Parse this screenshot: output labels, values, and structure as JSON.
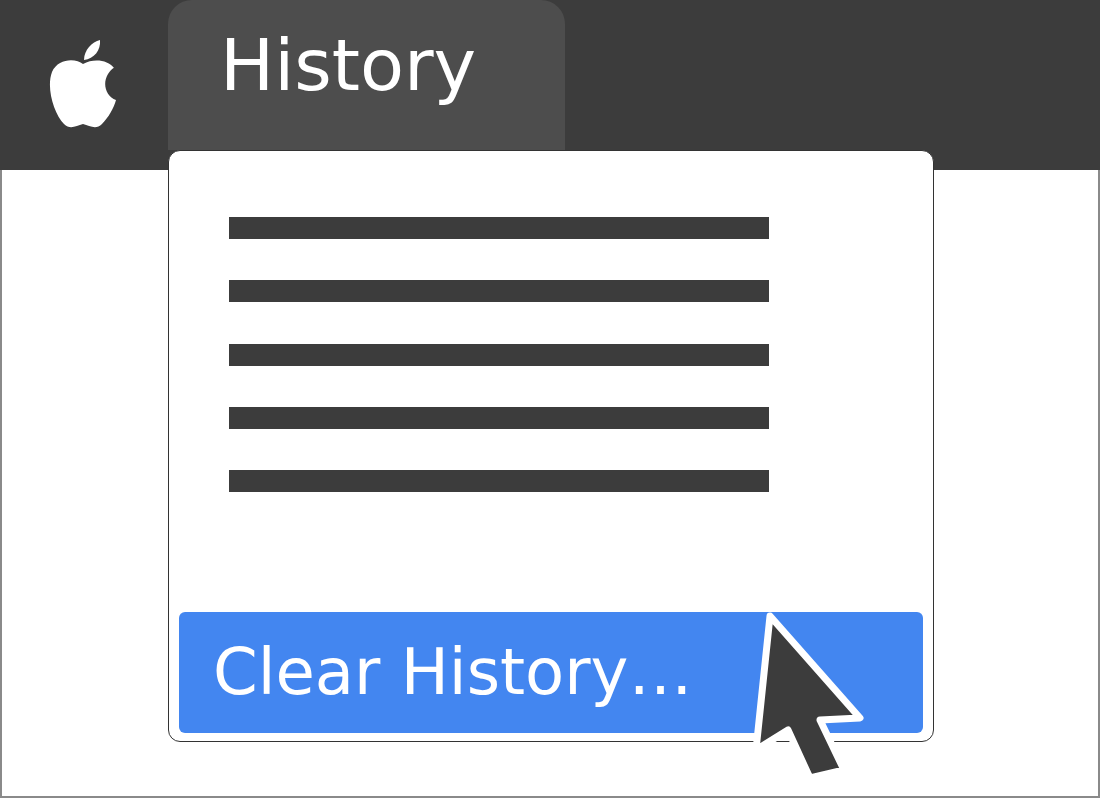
{
  "menu": {
    "title": "History",
    "open": true
  },
  "items": [
    {
      "kind": "placeholder",
      "selected": false
    },
    {
      "kind": "placeholder",
      "selected": false
    },
    {
      "kind": "placeholder",
      "selected": false
    },
    {
      "kind": "placeholder",
      "selected": false
    },
    {
      "kind": "placeholder",
      "selected": false
    },
    {
      "kind": "command",
      "label": "Clear History…",
      "selected": true
    }
  ]
}
